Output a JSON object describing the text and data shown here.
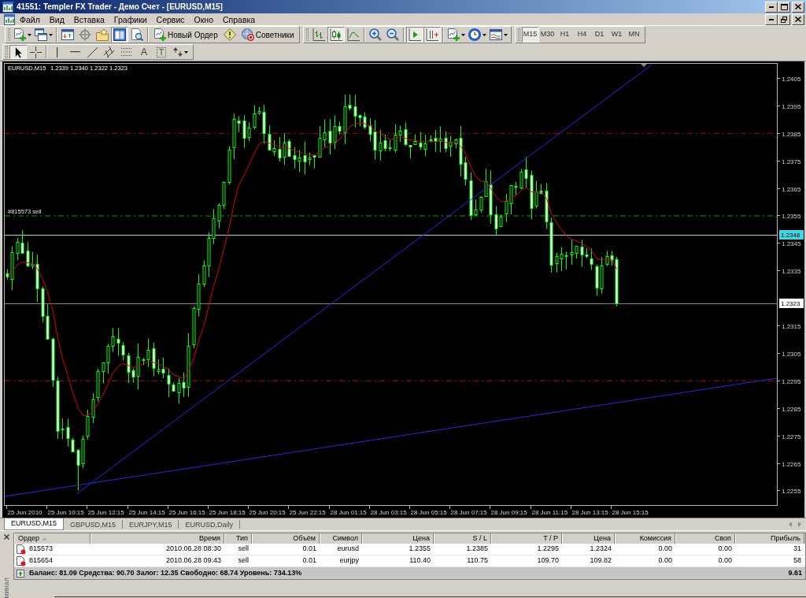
{
  "window": {
    "title": "41551: Templer FX Trader - Демо Счет - [EURUSD,M15]"
  },
  "menu": [
    "Файл",
    "Вид",
    "Вставка",
    "Графики",
    "Сервис",
    "Окно",
    "Справка"
  ],
  "toolbars": {
    "standard": {
      "groups": [
        {
          "tools": [
            {
              "kind": "dropdown",
              "pressed": false
            },
            {
              "kind": "dropdown",
              "pressed": false
            }
          ]
        },
        {
          "tools": [
            {
              "kind": "icon",
              "pressed": false
            },
            {
              "kind": "icon",
              "pressed": false
            },
            {
              "kind": "icon",
              "pressed": false
            },
            {
              "kind": "icon",
              "pressed": true
            },
            {
              "kind": "icon",
              "pressed": false
            }
          ]
        },
        {
          "tools": [
            {
              "kind": "labeled",
              "label": "Новый Ордер",
              "pressed": false
            },
            {
              "kind": "icon",
              "pressed": false
            },
            {
              "kind": "labeled",
              "label": "Советники",
              "pressed": false
            }
          ]
        }
      ]
    },
    "charts": {
      "groups": [
        {
          "tools": [
            {
              "kind": "icon",
              "pressed": false
            },
            {
              "kind": "icon",
              "pressed": true
            },
            {
              "kind": "icon",
              "pressed": false
            }
          ]
        },
        {
          "tools": [
            {
              "kind": "icon",
              "pressed": false
            },
            {
              "kind": "icon",
              "pressed": false
            }
          ]
        },
        {
          "tools": [
            {
              "kind": "icon",
              "pressed": true
            },
            {
              "kind": "icon",
              "pressed": true
            }
          ]
        },
        {
          "tools": [
            {
              "kind": "dropdown",
              "pressed": false
            },
            {
              "kind": "dropdown",
              "pressed": false
            },
            {
              "kind": "dropdown",
              "pressed": false
            }
          ]
        }
      ]
    },
    "periods": [
      {
        "label": "M15",
        "selected": true
      },
      {
        "label": "M30",
        "selected": false
      },
      {
        "label": "H1",
        "selected": false
      },
      {
        "label": "H4",
        "selected": false
      },
      {
        "label": "D1",
        "selected": false
      },
      {
        "label": "W1",
        "selected": false
      },
      {
        "label": "MN",
        "selected": false
      }
    ],
    "line_studies": {
      "groups": [
        {
          "tools": [
            {
              "kind": "icon",
              "selected": true
            },
            {
              "kind": "icon",
              "selected": false
            }
          ]
        },
        {
          "tools": [
            {
              "kind": "icon",
              "selected": false
            },
            {
              "kind": "icon",
              "selected": false
            },
            {
              "kind": "icon",
              "selected": false
            },
            {
              "kind": "icon",
              "selected": false
            },
            {
              "kind": "icon",
              "selected": false
            },
            {
              "kind": "glyph",
              "label": "A",
              "selected": false
            },
            {
              "kind": "framed_glyph",
              "label": "T",
              "selected": false
            },
            {
              "kind": "dropdown",
              "selected": false
            }
          ]
        }
      ]
    }
  },
  "chart": {
    "symbol": "EURUSD,M15",
    "quote": "1.2339 1.2340 1.2322 1.2323",
    "order_label": "#815573 sell",
    "price_ticks": [
      "1.2405",
      "1.2395",
      "1.2385",
      "1.2375",
      "1.2365",
      "1.2355",
      "1.2345",
      "1.2335",
      "1.2315",
      "1.2305",
      "1.2295",
      "1.2285",
      "1.2275",
      "1.2265",
      "1.2255"
    ],
    "price_markers": [
      {
        "label": "1.2348",
        "color": "#40d8e0"
      },
      {
        "label": "1.2323",
        "color": "#ffffff"
      }
    ],
    "time_ticks": [
      "25 Jun 2010",
      "25 Jun 10:15",
      "25 Jun 12:15",
      "25 Jun 14:15",
      "25 Jun 16:15",
      "25 Jun 18:15",
      "25 Jun 20:15",
      "25 Jun 22:15",
      "28 Jun 01:15",
      "28 Jun 03:15",
      "28 Jun 05:15",
      "28 Jun 07:15",
      "28 Jun 09:15",
      "28 Jun 11:15",
      "28 Jun 13:15",
      "28 Jun 15:15"
    ]
  },
  "chart_tabs": [
    {
      "label": "EURUSD,M15",
      "selected": true
    },
    {
      "label": "GBPUSD,M15",
      "selected": false
    },
    {
      "label": "EURJPY,M15",
      "selected": false
    },
    {
      "label": "EURUSD,Daily",
      "selected": false
    }
  ],
  "terminal": {
    "panel_title": "минал",
    "columns": [
      "Ордер",
      "Время",
      "Тип",
      "Объём",
      "Символ",
      "Цена",
      "S / L",
      "T / P",
      "Цена",
      "Комиссия",
      "Своп",
      "Прибыль"
    ],
    "rows": [
      {
        "cells": [
          "815573",
          "2010.06.28 08:30",
          "sell",
          "0.01",
          "eurusd",
          "1.2355",
          "1.2385",
          "1.2295",
          "1.2324",
          "0.00",
          "0.00",
          "31"
        ]
      },
      {
        "cells": [
          "815654",
          "2010.06.28 09:43",
          "sell",
          "0.01",
          "eurjpy",
          "110.40",
          "110.75",
          "109.70",
          "109.82",
          "0.00",
          "0.00",
          "58"
        ]
      }
    ],
    "summary": {
      "text": "Баланс: 81.09 Средства: 90.70 Залог: 12.35 Свободно: 68.74 Уровень: 734.13%",
      "profit": "9.61"
    }
  }
}
